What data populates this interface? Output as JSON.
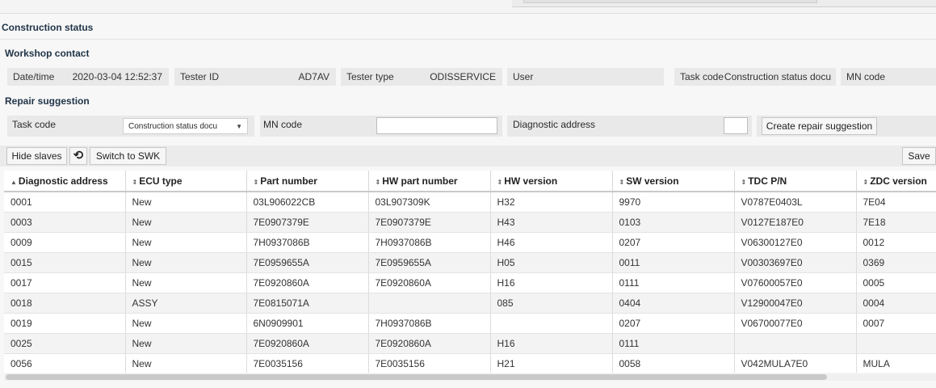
{
  "page": {
    "title": "Construction status",
    "workshop_heading": "Workshop contact",
    "repair_heading": "Repair suggestion"
  },
  "workshop": {
    "datetime_label": "Date/time",
    "datetime_value": "2020-03-04 12:52:37",
    "tester_id_label": "Tester ID",
    "tester_id_value": "AD7AV",
    "tester_type_label": "Tester type",
    "tester_type_value": "ODISSERVICE",
    "user_label": "User",
    "user_value": "",
    "task_code_label": "Task code",
    "task_code_value": "Construction status docu",
    "mn_code_label": "MN code",
    "mn_code_value": ""
  },
  "repair": {
    "task_code_label": "Task code",
    "task_code_selected": "Construction status docu",
    "mn_code_label": "MN code",
    "mn_code_value": "",
    "diag_address_label": "Diagnostic address",
    "diag_address_value": "",
    "create_button": "Create repair suggestion"
  },
  "toolbar": {
    "hide_slaves": "Hide slaves",
    "switch_swk": "Switch to SWK",
    "save": "Save",
    "refresh_icon": "refresh-icon"
  },
  "table": {
    "columns": [
      {
        "label": "Diagnostic address",
        "sort": "asc"
      },
      {
        "label": "ECU type",
        "sort": "both"
      },
      {
        "label": "Part number",
        "sort": "both"
      },
      {
        "label": "HW part number",
        "sort": "both"
      },
      {
        "label": "HW version",
        "sort": "both"
      },
      {
        "label": "SW version",
        "sort": "both"
      },
      {
        "label": "TDC P/N",
        "sort": "both"
      },
      {
        "label": "ZDC version",
        "sort": "both"
      }
    ],
    "rows": [
      [
        "0001",
        "New",
        "03L906022CB",
        "03L907309K",
        "H32",
        "9970",
        "V0787E0403L",
        "7E04"
      ],
      [
        "0003",
        "New",
        "7E0907379E",
        "7E0907379E",
        "H43",
        "0103",
        "V0127E187E0",
        "7E18"
      ],
      [
        "0009",
        "New",
        "7H0937086B",
        "7H0937086B",
        "H46",
        "0207",
        "V06300127E0",
        "0012"
      ],
      [
        "0015",
        "New",
        "7E0959655A",
        "7E0959655A",
        "H05",
        "0011",
        "V00303697E0",
        "0369"
      ],
      [
        "0017",
        "New",
        "7E0920860A",
        "7E0920860A",
        "H16",
        "0111",
        "V07600057E0",
        "0005"
      ],
      [
        "0018",
        "ASSY",
        "7E0815071A",
        "",
        "085",
        "0404",
        "V12900047E0",
        "0004"
      ],
      [
        "0019",
        "New",
        "6N0909901",
        "7H0937086B",
        "",
        "0207",
        "V06700077E0",
        "0007"
      ],
      [
        "0025",
        "New",
        "7E0920860A",
        "7E0920860A",
        "H16",
        "0111",
        "",
        ""
      ],
      [
        "0056",
        "New",
        "7E0035156",
        "7E0035156",
        "H21",
        "0058",
        "V042MULA7E0",
        "MULA"
      ]
    ]
  }
}
